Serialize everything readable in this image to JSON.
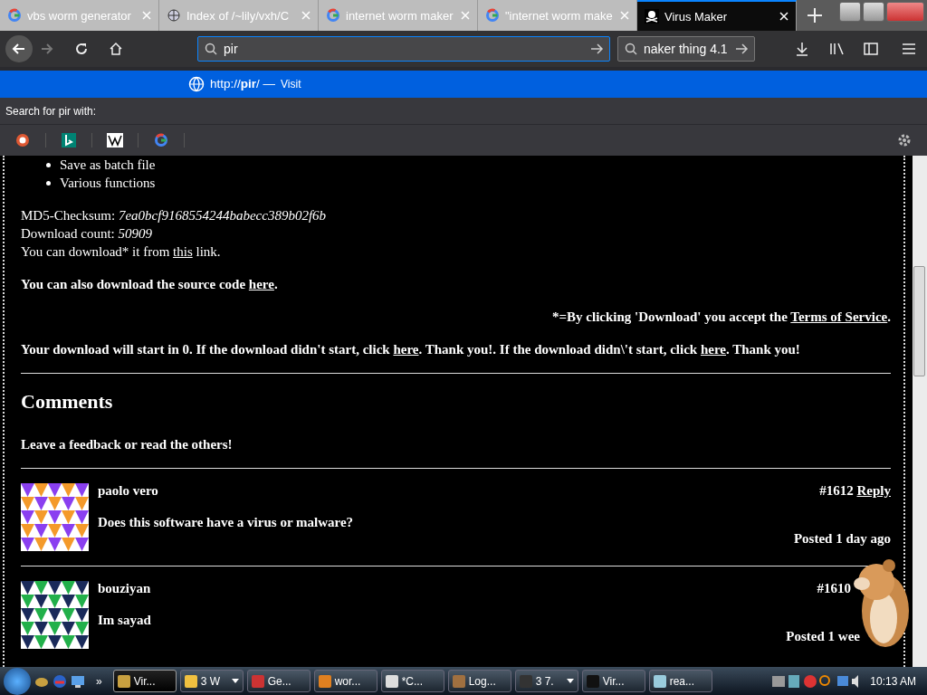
{
  "tabs": [
    {
      "title": "vbs worm generator",
      "kind": "google",
      "selected": false
    },
    {
      "title": "Index of /~lily/vxh/C",
      "kind": "site",
      "selected": false
    },
    {
      "title": "internet worm maker",
      "kind": "google",
      "selected": false
    },
    {
      "title": "\"internet worm make",
      "kind": "google",
      "selected": false
    },
    {
      "title": "Virus Maker",
      "kind": "pirate",
      "selected": true
    }
  ],
  "address_bar": {
    "value": "pir"
  },
  "search_box": {
    "value": "naker thing 4.1"
  },
  "suggestion": {
    "url_prefix": "http://",
    "url_bold": "pir",
    "url_suffix": "/ —",
    "action": "Visit"
  },
  "search_with": {
    "label": "Search for pir with:",
    "engines": [
      {
        "kind": "duckduckgo"
      },
      {
        "kind": "bing"
      },
      {
        "kind": "wikipedia"
      },
      {
        "kind": "google"
      }
    ]
  },
  "page": {
    "features": [
      "Save as batch file",
      "Various functions"
    ],
    "checksum": {
      "label": "MD5-Checksum:",
      "value": "7ea0bcf9168554244babecc389b02f6b"
    },
    "download_count": {
      "label": "Download count:",
      "value": "50909"
    },
    "download_line": {
      "before": "You can download* it from",
      "link": "this",
      "after": "link."
    },
    "source_line": {
      "before": "You can also download the source code",
      "link": "here",
      "after": "."
    },
    "terms_line": {
      "before": "*=By clicking 'Download' you accept the",
      "link": "Terms of Service",
      "after": "."
    },
    "start_line": {
      "text_1": "Your download will start in 0. If the download didn't start, click",
      "link_1": "here",
      "text_2": ". Thank you!. If the download didn\\'t start, click",
      "link_2": "here",
      "text_3": ". Thank you!"
    },
    "comments_heading": "Comments",
    "comments_intro": "Leave a feedback or read the others!",
    "comments": [
      {
        "author": "paolo vero",
        "number": "#1612",
        "reply": "Reply",
        "text": "Does this software have a virus or malware?",
        "posted": "Posted 1 day ago"
      },
      {
        "author": "bouziyan",
        "number": "#1610",
        "text": "Im sayad",
        "posted": "Posted 1 wee"
      }
    ]
  },
  "taskbar": {
    "buttons": [
      {
        "label": "Vir...",
        "selected": true,
        "menu": false
      },
      {
        "label": "3 W",
        "selected": false,
        "menu": true
      },
      {
        "label": "Ge...",
        "selected": false,
        "menu": false
      },
      {
        "label": "wor...",
        "selected": false,
        "menu": false
      },
      {
        "label": "*C...",
        "selected": false,
        "menu": false
      },
      {
        "label": "Log...",
        "selected": false,
        "menu": false
      },
      {
        "label": "3 7.",
        "selected": false,
        "menu": true
      },
      {
        "label": "Vir...",
        "selected": false,
        "menu": false
      },
      {
        "label": "rea...",
        "selected": false,
        "menu": false
      }
    ],
    "more": "»",
    "clock": "10:13 AM"
  }
}
